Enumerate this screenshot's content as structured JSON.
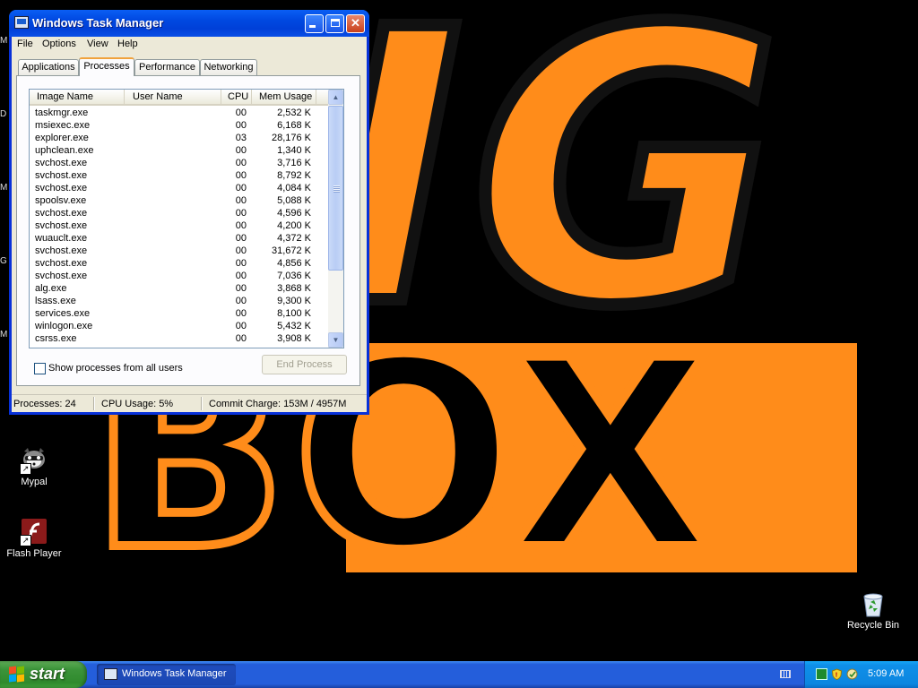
{
  "window": {
    "title": "Windows Task Manager",
    "menu": [
      "File",
      "Options",
      "View",
      "Help"
    ],
    "tabs": [
      "Applications",
      "Processes",
      "Performance",
      "Networking"
    ],
    "active_tab": "Processes",
    "columns": [
      "Image Name",
      "User Name",
      "CPU",
      "Mem Usage"
    ],
    "processes": [
      {
        "name": "taskmgr.exe",
        "user": "",
        "cpu": "00",
        "mem": "2,532 K"
      },
      {
        "name": "msiexec.exe",
        "user": "",
        "cpu": "00",
        "mem": "6,168 K"
      },
      {
        "name": "explorer.exe",
        "user": "",
        "cpu": "03",
        "mem": "28,176 K"
      },
      {
        "name": "uphclean.exe",
        "user": "",
        "cpu": "00",
        "mem": "1,340 K"
      },
      {
        "name": "svchost.exe",
        "user": "",
        "cpu": "00",
        "mem": "3,716 K"
      },
      {
        "name": "svchost.exe",
        "user": "",
        "cpu": "00",
        "mem": "8,792 K"
      },
      {
        "name": "svchost.exe",
        "user": "",
        "cpu": "00",
        "mem": "4,084 K"
      },
      {
        "name": "spoolsv.exe",
        "user": "",
        "cpu": "00",
        "mem": "5,088 K"
      },
      {
        "name": "svchost.exe",
        "user": "",
        "cpu": "00",
        "mem": "4,596 K"
      },
      {
        "name": "svchost.exe",
        "user": "",
        "cpu": "00",
        "mem": "4,200 K"
      },
      {
        "name": "wuauclt.exe",
        "user": "",
        "cpu": "00",
        "mem": "4,372 K"
      },
      {
        "name": "svchost.exe",
        "user": "",
        "cpu": "00",
        "mem": "31,672 K"
      },
      {
        "name": "svchost.exe",
        "user": "",
        "cpu": "00",
        "mem": "4,856 K"
      },
      {
        "name": "svchost.exe",
        "user": "",
        "cpu": "00",
        "mem": "7,036 K"
      },
      {
        "name": "alg.exe",
        "user": "",
        "cpu": "00",
        "mem": "3,868 K"
      },
      {
        "name": "lsass.exe",
        "user": "",
        "cpu": "00",
        "mem": "9,300 K"
      },
      {
        "name": "services.exe",
        "user": "",
        "cpu": "00",
        "mem": "8,100 K"
      },
      {
        "name": "winlogon.exe",
        "user": "",
        "cpu": "00",
        "mem": "5,432 K"
      },
      {
        "name": "csrss.exe",
        "user": "",
        "cpu": "00",
        "mem": "3,908 K"
      }
    ],
    "show_all_label": "Show processes from all users",
    "show_all_checked": false,
    "end_process_label": "End Process",
    "status": {
      "processes": "Processes: 24",
      "cpu": "CPU Usage: 5%",
      "commit": "Commit Charge: 153M / 4957M"
    }
  },
  "desktop": {
    "icons": [
      {
        "label": "Mypal",
        "icon": "mypal-raccoon-icon"
      },
      {
        "label": "Flash Player",
        "icon": "flash-player-icon"
      },
      {
        "label": "Recycle Bin",
        "icon": "recycle-bin-icon"
      }
    ],
    "wallpaper": {
      "big_text": "IG",
      "box_text": "BOX",
      "colors": {
        "orange": "#ff8c1a",
        "background": "#000000"
      }
    }
  },
  "taskbar": {
    "start_label": "start",
    "task_button_label": "Windows Task Manager",
    "clock": "5:09 AM",
    "tray_icons": [
      "network-icon",
      "security-shield-icon",
      "update-icon"
    ]
  }
}
